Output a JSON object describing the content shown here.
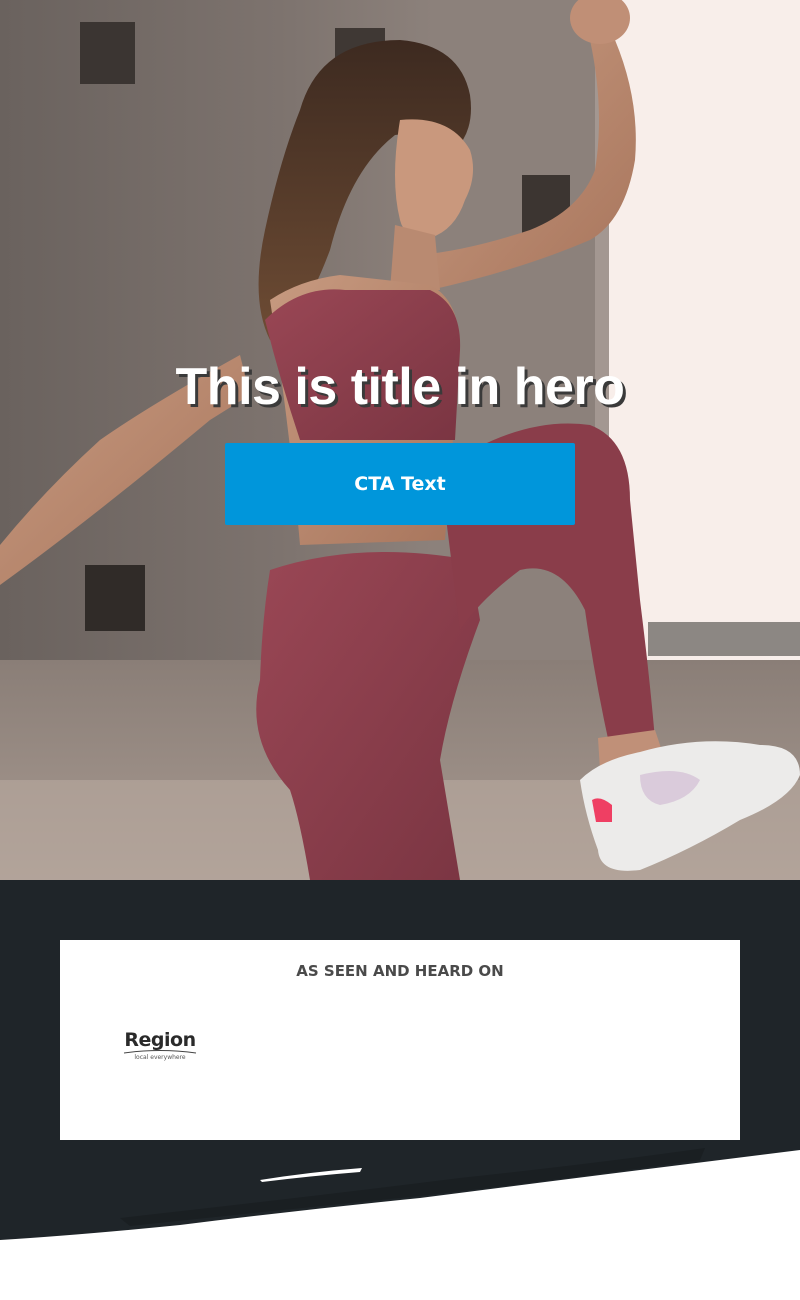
{
  "hero": {
    "title": "This is title in hero",
    "cta_label": "CTA Text",
    "background_image": "woman-fitness-high-knee-pose",
    "colors": {
      "cta": "#0096db",
      "title": "#ffffff",
      "outfit": "#8a3d4a",
      "wall": "#756c67",
      "window": "#f8eeea"
    }
  },
  "press": {
    "heading": "AS SEEN AND HEARD ON",
    "logos": [
      {
        "name": "Region",
        "tagline": "local everywhere",
        "icon": "region-logo"
      }
    ],
    "colors": {
      "section_bg": "#1f2529",
      "card_bg": "#ffffff",
      "heading": "#4a4a4a"
    }
  }
}
